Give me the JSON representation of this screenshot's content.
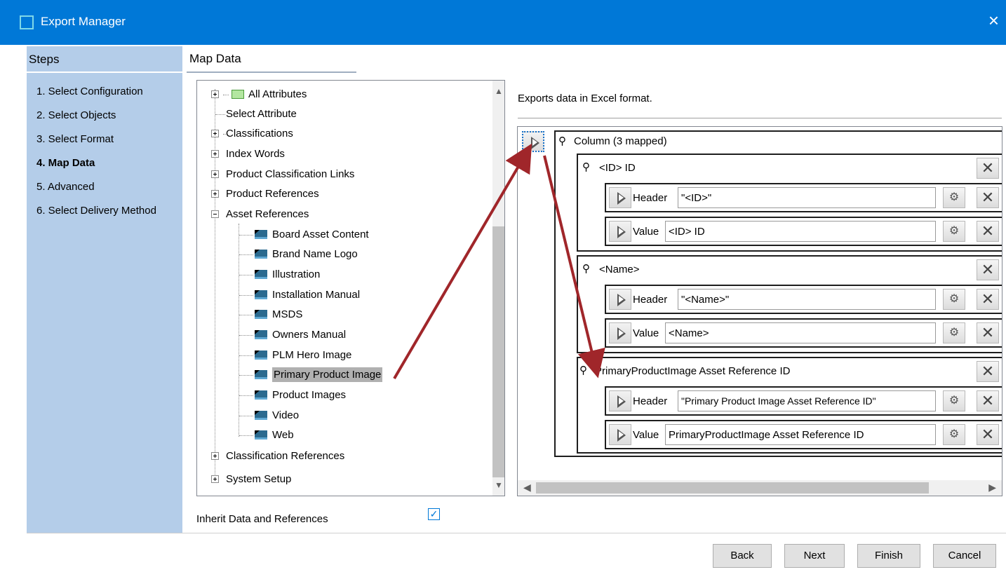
{
  "window": {
    "title": "Export Manager",
    "close_icon": "×"
  },
  "steps": {
    "heading": "Steps",
    "items": [
      {
        "label": "1. Select Configuration"
      },
      {
        "label": "2. Select Objects"
      },
      {
        "label": "3. Select Format"
      },
      {
        "label": "4. Map Data",
        "active": true
      },
      {
        "label": "5. Advanced"
      },
      {
        "label": "6. Select Delivery Method"
      }
    ]
  },
  "page": {
    "title": "Map Data"
  },
  "tree": {
    "nodes": [
      {
        "label": "All Attributes"
      },
      {
        "label": "Select Attribute"
      },
      {
        "label": "Classifications"
      },
      {
        "label": "Index Words"
      },
      {
        "label": "Product Classification Links"
      },
      {
        "label": "Product References"
      },
      {
        "label": "Asset References"
      },
      {
        "label": "Board Asset Content"
      },
      {
        "label": "Brand Name Logo"
      },
      {
        "label": "Illustration"
      },
      {
        "label": "Installation Manual"
      },
      {
        "label": "MSDS"
      },
      {
        "label": "Owners Manual"
      },
      {
        "label": "PLM Hero Image"
      },
      {
        "label": "Primary Product Image",
        "selected": true
      },
      {
        "label": "Product Images"
      },
      {
        "label": "Video"
      },
      {
        "label": "Web"
      },
      {
        "label": "Classification References"
      },
      {
        "label": "System Setup"
      }
    ]
  },
  "inherit": {
    "label": "Inherit Data and References",
    "checked": true,
    "check_glyph": "✓"
  },
  "format": {
    "description": "Exports data in Excel format."
  },
  "mapping": {
    "column_label": "Column (3 mapped)",
    "columns": [
      {
        "name": "<ID> ID",
        "header_label": "Header",
        "header_value": "\"<ID>\"",
        "value_label": "Value",
        "value_value": "<ID> ID"
      },
      {
        "name": "<Name>",
        "header_label": "Header",
        "header_value": "\"<Name>\"",
        "value_label": "Value",
        "value_value": "<Name>"
      },
      {
        "name": "PrimaryProductImage Asset Reference ID",
        "header_label": "Header",
        "header_value": "\"Primary Product Image Asset Reference ID\"",
        "value_label": "Value",
        "value_value": "PrimaryProductImage Asset Reference ID"
      }
    ]
  },
  "buttons": {
    "back": "Back",
    "next": "Next",
    "finish": "Finish",
    "cancel": "Cancel"
  },
  "colors": {
    "titlebar": "#0078d7",
    "steps_panel": "#b4cde9",
    "annotation_arrow": "#a0262a"
  }
}
